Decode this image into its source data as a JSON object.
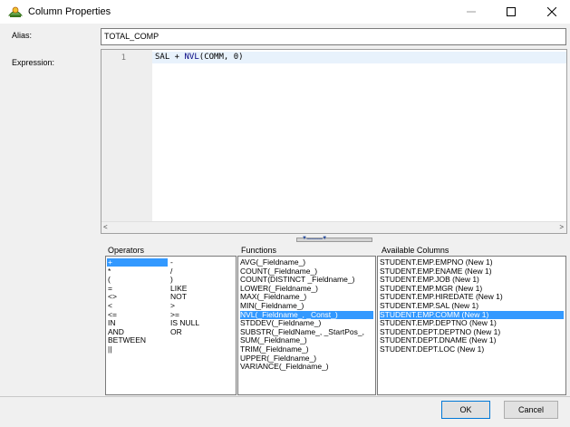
{
  "window": {
    "title": "Column Properties",
    "minimize": "—",
    "maximize": "☐",
    "close": "✕"
  },
  "alias": {
    "label": "Alias:",
    "value": "TOTAL_COMP"
  },
  "expression": {
    "label": "Expression:",
    "line_number": "1",
    "code_part1": "SAL + ",
    "code_kw": "NVL",
    "code_part2": "(COMM, 0)",
    "scroll_left": "<",
    "scroll_right": ">"
  },
  "splitter_text": "▼..........................▼",
  "operators": {
    "title": "Operators",
    "rows": [
      {
        "a": "+",
        "b": "-"
      },
      {
        "a": "*",
        "b": "/"
      },
      {
        "a": "(",
        "b": ")"
      },
      {
        "a": "=",
        "b": "LIKE"
      },
      {
        "a": "<>",
        "b": "NOT"
      },
      {
        "a": "<",
        "b": ">"
      },
      {
        "a": "<=",
        "b": ">="
      },
      {
        "a": "IN",
        "b": "IS NULL"
      },
      {
        "a": "AND",
        "b": "OR"
      },
      {
        "a": "BETWEEN",
        "b": ""
      },
      {
        "a": "||",
        "b": ""
      }
    ],
    "selected_index": 0
  },
  "functions": {
    "title": "Functions",
    "items": [
      "AVG(_Fieldname_)",
      "COUNT(_Fieldname_)",
      "COUNT(DISTINCT _Fieldname_)",
      "LOWER(_Fieldname_)",
      "MAX(_Fieldname_)",
      "MIN(_Fieldname_)",
      "NVL(_Fieldname_, _Const_)",
      "STDDEV(_Fieldname_)",
      "SUBSTR(_FieldName_, _StartPos_,",
      "SUM(_Fieldname_)",
      "TRIM(_Fieldname_)",
      "UPPER(_Fieldname_)",
      "VARIANCE(_Fieldname_)"
    ],
    "selected_index": 6
  },
  "columns": {
    "title": "Available Columns",
    "items": [
      "STUDENT.EMP.EMPNO (New 1)",
      "STUDENT.EMP.ENAME (New 1)",
      "STUDENT.EMP.JOB (New 1)",
      "STUDENT.EMP.MGR (New 1)",
      "STUDENT.EMP.HIREDATE (New 1)",
      "STUDENT.EMP.SAL (New 1)",
      "STUDENT.EMP.COMM (New 1)",
      "STUDENT.EMP.DEPTNO (New 1)",
      "STUDENT.DEPT.DEPTNO (New 1)",
      "STUDENT.DEPT.DNAME (New 1)",
      "STUDENT.DEPT.LOC (New 1)"
    ],
    "selected_index": 6
  },
  "buttons": {
    "ok": "OK",
    "cancel": "Cancel"
  },
  "colors": {
    "selection": "#3399ff",
    "keyword": "#00007f"
  }
}
